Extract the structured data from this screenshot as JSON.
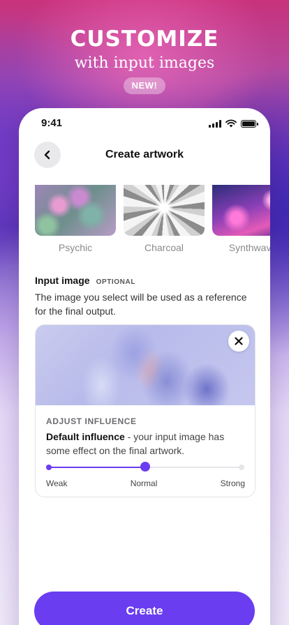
{
  "hero": {
    "title": "CUSTOMIZE",
    "subtitle": "with input images",
    "badge": "NEW!"
  },
  "status_bar": {
    "time": "9:41",
    "icons": [
      "signal-icon",
      "wifi-icon",
      "battery-icon"
    ]
  },
  "header": {
    "title": "Create artwork",
    "back_icon": "chevron-left-icon"
  },
  "styles": [
    {
      "label": "Psychic"
    },
    {
      "label": "Charcoal"
    },
    {
      "label": "Synthwave"
    }
  ],
  "input_image": {
    "title": "Input image",
    "tag": "OPTIONAL",
    "description": "The image you select will be used as a reference for the final output.",
    "remove_icon": "close-icon"
  },
  "influence": {
    "label": "ADJUST INFLUENCE",
    "level_name": "Default influence",
    "level_description": " - your input image has some effect on the final artwork.",
    "value_fraction": 0.5,
    "scale": [
      "Weak",
      "Normal",
      "Strong"
    ]
  },
  "colors": {
    "accent": "#6a3df0",
    "track": "#e5e5ea"
  },
  "actions": {
    "create_label": "Create"
  }
}
